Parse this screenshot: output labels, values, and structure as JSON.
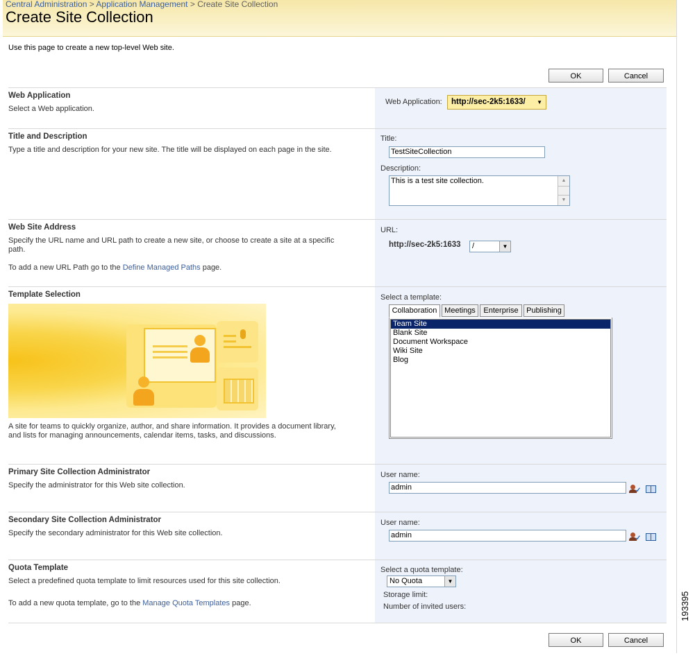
{
  "breadcrumb": {
    "items": [
      "Central Administration",
      "Application Management",
      "Create Site Collection"
    ],
    "separator": ">"
  },
  "page_title": "Create Site Collection",
  "intro": "Use this page to create a new top-level Web site.",
  "buttons": {
    "ok": "OK",
    "cancel": "Cancel"
  },
  "web_application": {
    "title": "Web Application",
    "desc": "Select a Web application.",
    "label": "Web Application:",
    "value": "http://sec-2k5:1633/"
  },
  "title_description": {
    "title": "Title and Description",
    "desc": "Type a title and description for your new site. The title will be displayed on each page in the site.",
    "title_label": "Title:",
    "title_value": "TestSiteCollection",
    "desc_label": "Description:",
    "desc_value": "This is a test site collection."
  },
  "web_site_address": {
    "title": "Web Site Address",
    "desc": "Specify the URL name and URL path to create a new site, or choose to create a site at a specific path.",
    "link_pre": "To add a new URL Path go to the",
    "link": "Define Managed Paths",
    "link_post": "page.",
    "url_label": "URL:",
    "url_prefix": "http://sec-2k5:1633",
    "path_value": "/"
  },
  "template_selection": {
    "title": "Template Selection",
    "desc": "A site for teams to quickly organize, author, and share information. It provides a document library, and lists for managing announcements, calendar items, tasks, and discussions.",
    "label": "Select a template:",
    "tabs": [
      "Collaboration",
      "Meetings",
      "Enterprise",
      "Publishing"
    ],
    "items": [
      "Team Site",
      "Blank Site",
      "Document Workspace",
      "Wiki Site",
      "Blog"
    ]
  },
  "primary_admin": {
    "title": "Primary Site Collection Administrator",
    "desc": "Specify the administrator for this Web site collection.",
    "label": "User name:",
    "value": "admin"
  },
  "secondary_admin": {
    "title": "Secondary Site Collection Administrator",
    "desc": "Specify the secondary administrator for this Web site collection.",
    "label": "User name:",
    "value": "admin"
  },
  "quota": {
    "title": "Quota Template",
    "desc": "Select a predefined quota template to limit resources used for this site collection.",
    "link_pre": "To add a new quota template, go to the",
    "link": "Manage Quota Templates",
    "link_post": "page.",
    "label": "Select a quota template:",
    "value": "No Quota",
    "storage_label": "Storage limit:",
    "users_label": "Number of invited users:"
  },
  "figure_number": "193395"
}
